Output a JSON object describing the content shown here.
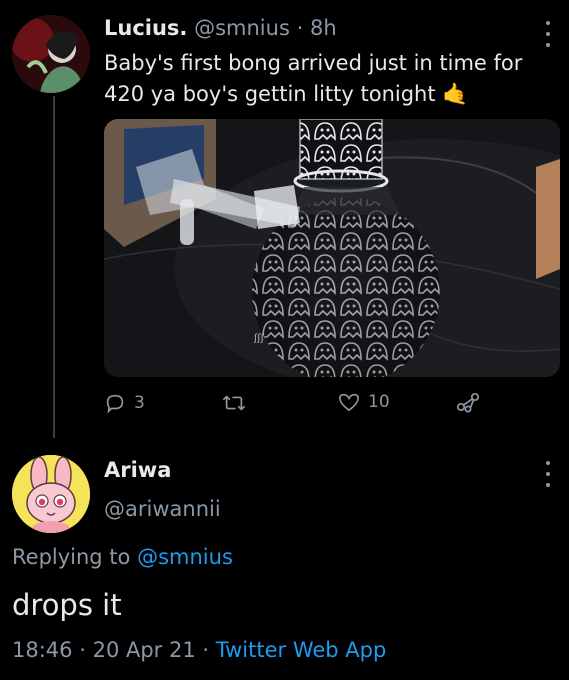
{
  "tweet1": {
    "name": "Lucius.",
    "handle": "@smnius",
    "dot": "·",
    "age": "8h",
    "text_line1": "Baby's first bong arrived just in time for",
    "text_line2": "420 ya boy's gettin litty tonight",
    "emoji": "🤙",
    "actions": {
      "reply_count": "3",
      "retweet_count": "",
      "like_count": "10"
    }
  },
  "tweet2": {
    "name": "Ariwa",
    "handle": "@ariwannii",
    "replying_prefix": "Replying to",
    "replying_handle": "@smnius",
    "body": "drops it",
    "time": "18:46",
    "sep1": "·",
    "date": "20 Apr 21",
    "sep2": "·",
    "source": "Twitter Web App"
  },
  "colors": {
    "background": "#000000",
    "text": "#e7e9ea",
    "muted": "#8b98a5",
    "link": "#1d9bf0"
  },
  "icons": [
    "more-vertical-icon",
    "reply-icon",
    "retweet-icon",
    "like-icon",
    "share-icon"
  ]
}
